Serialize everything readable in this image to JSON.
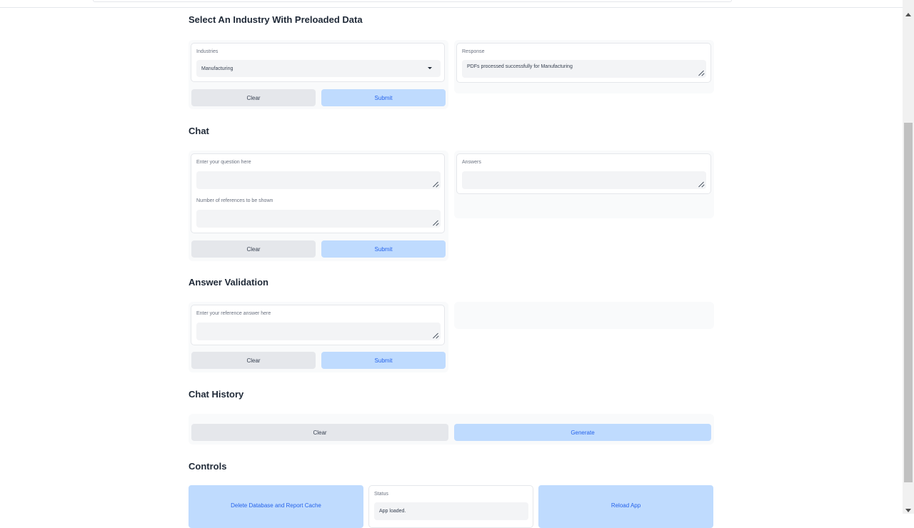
{
  "sections": {
    "industry": {
      "title": "Select An Industry With Preloaded Data"
    },
    "chat": {
      "title": "Chat"
    },
    "validation": {
      "title": "Answer Validation"
    },
    "history": {
      "title": "Chat History"
    },
    "controls": {
      "title": "Controls"
    }
  },
  "industry": {
    "select_label": "Industries",
    "select_value": "Manufacturing",
    "response_label": "Response",
    "response_value": "PDFs processed successfully for Manufacturing",
    "clear_label": "Clear",
    "submit_label": "Submit"
  },
  "chat": {
    "question_label": "Enter your question here",
    "question_value": "",
    "refs_label": "Number of references to be shown",
    "refs_value": "",
    "answers_label": "Answers",
    "answers_value": "",
    "clear_label": "Clear",
    "submit_label": "Submit"
  },
  "validation": {
    "reference_label": "Enter your reference answer here",
    "reference_value": "",
    "clear_label": "Clear",
    "submit_label": "Submit"
  },
  "history": {
    "clear_label": "Clear",
    "generate_label": "Generate"
  },
  "controls": {
    "delete_label": "Delete Database and Report Cache",
    "status_label": "Status",
    "status_value": "App loaded.",
    "reload_label": "Reload App"
  },
  "colors": {
    "primary_bg": "#bfdbfe",
    "primary_text": "#2563eb",
    "secondary_bg": "#e5e7eb"
  }
}
